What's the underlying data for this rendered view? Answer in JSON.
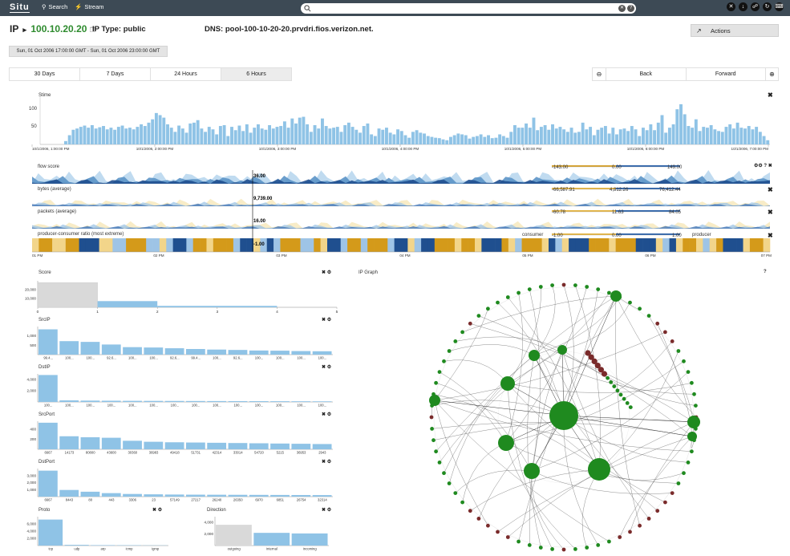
{
  "app": {
    "brand": "Situ",
    "nav": [
      {
        "label": "Search"
      },
      {
        "label": "Stream"
      }
    ],
    "search": {
      "value": "",
      "placeholder": ""
    }
  },
  "header": {
    "ip_label": "IP",
    "ip_value": "100.10.20.20",
    "ip_type": "IP Type: public",
    "dns": "DNS: pool-100-10-20-20.prvdri.fios.verizon.net.",
    "actions_label": "Actions",
    "date_range": "Sun, 01 Oct 2006 17:00:00 GMT - Sun, 01 Oct 2006 23:00:00 GMT"
  },
  "range_tabs": [
    {
      "label": "30 Days",
      "active": false
    },
    {
      "label": "7 Days",
      "active": false
    },
    {
      "label": "24 Hours",
      "active": false
    },
    {
      "label": "6 Hours",
      "active": true
    }
  ],
  "nav_tabs": {
    "back": "Back",
    "forward": "Forward"
  },
  "stime": {
    "title": "Stime",
    "y_ticks": [
      "100",
      "50"
    ],
    "x_labels": [
      "10/1/2006, 1:00:00 PM",
      "10/1/2006, 2:00:00 PM",
      "10/1/2006, 3:00:00 PM",
      "10/1/2006, 4:00:00 PM",
      "10/1/2006, 5:00:00 PM",
      "10/1/2006, 6:00:00 PM",
      "10/1/2006, 7:00:00 PM"
    ],
    "values": [
      8,
      22,
      35,
      38,
      42,
      45,
      40,
      46,
      38,
      41,
      44,
      36,
      40,
      35,
      42,
      45,
      38,
      40,
      36,
      42,
      48,
      44,
      52,
      60,
      75,
      70,
      64,
      48,
      40,
      30,
      45,
      38,
      28,
      50,
      52,
      58,
      38,
      30,
      42,
      36,
      24,
      44,
      46,
      20,
      42,
      34,
      45,
      32,
      48,
      28,
      40,
      48,
      38,
      35,
      46,
      38,
      42,
      44,
      55,
      40,
      62,
      50,
      64,
      66,
      48,
      30,
      46,
      38,
      62,
      44,
      38,
      40,
      42,
      30,
      46,
      52,
      42,
      35,
      28,
      44,
      50,
      24,
      20,
      38,
      35,
      40,
      28,
      24,
      36,
      32,
      22,
      16,
      30,
      34,
      28,
      26,
      20,
      18,
      16,
      15,
      12,
      10,
      18,
      22,
      26,
      24,
      22,
      14,
      18,
      20,
      24,
      18,
      22,
      15,
      16,
      24,
      20,
      16,
      30,
      46,
      40,
      40,
      50,
      40,
      64,
      34,
      42,
      46,
      35,
      48,
      38,
      42,
      36,
      30,
      40,
      28,
      30,
      52,
      36,
      42,
      22,
      35,
      40,
      44,
      26,
      40,
      24,
      36,
      38,
      32,
      44,
      36,
      20,
      40,
      34,
      48,
      34,
      52,
      70,
      28,
      40,
      48,
      84,
      96,
      72,
      44,
      40,
      60,
      32,
      42,
      40,
      46,
      36,
      32,
      30,
      42,
      48,
      38,
      52,
      40,
      38,
      44,
      36,
      42,
      30,
      20,
      10
    ]
  },
  "tracks": [
    {
      "title": "flow score",
      "readout": "36.00",
      "legend": [
        "-143.00",
        "0.00",
        "149.00"
      ]
    },
    {
      "title": "bytes (average)",
      "readout": "9,739.00",
      "legend": [
        "-66,587.91",
        "4,812.26",
        "76,412.44"
      ]
    },
    {
      "title": "packets (average)",
      "readout": "16.00",
      "legend": [
        "-60.78",
        "11.63",
        "84.05"
      ]
    },
    {
      "title": "producer-consumer ratio (most extreme)",
      "readout": "-1.00",
      "legend": [
        "-1.00",
        "0.00",
        "1.00"
      ],
      "left_label": "consumer",
      "right_label": "producer"
    }
  ],
  "track_axis": [
    "01 PM",
    "02 PM",
    "03 PM",
    "04 PM",
    "05 PM",
    "06 PM",
    "07 PM"
  ],
  "histograms": {
    "score": {
      "title": "Score",
      "y_ticks": [
        "20,000",
        "10,000"
      ],
      "x_ticks": [
        "0",
        "1",
        "2",
        "3",
        "4",
        "5"
      ],
      "values": [
        28000,
        7000,
        1600,
        0,
        0
      ],
      "colors": [
        "#d9d9d9",
        "#8fc3e6",
        "#8fc3e6",
        "#8fc3e6",
        "#8fc3e6"
      ]
    },
    "srcip": {
      "title": "SrcIP",
      "y_ticks": [
        "1,000",
        "500"
      ],
      "categories": [
        "99.4...",
        "100...",
        "100...",
        "92.6...",
        "100...",
        "100...",
        "92.6...",
        "99.4...",
        "100...",
        "92.6...",
        "100...",
        "100...",
        "100...",
        "100..."
      ],
      "values": [
        1350,
        720,
        680,
        540,
        400,
        380,
        340,
        300,
        270,
        250,
        220,
        210,
        190,
        180
      ]
    },
    "dstip": {
      "title": "DstIP",
      "y_ticks": [
        "4,000",
        "2,000"
      ],
      "categories": [
        "100...",
        "100...",
        "100...",
        "100...",
        "100...",
        "100...",
        "100...",
        "100...",
        "100...",
        "100...",
        "100...",
        "100...",
        "100...",
        "100..."
      ],
      "values": [
        4800,
        280,
        240,
        220,
        200,
        190,
        180,
        170,
        160,
        150,
        140,
        130,
        120,
        110
      ]
    },
    "srcport": {
      "title": "SrcPort",
      "y_ticks": [
        "400",
        "200"
      ],
      "categories": [
        "6667",
        "14173",
        "80800",
        "43600",
        "30360",
        "36983",
        "49418",
        "51731",
        "42314",
        "33014",
        "54720",
        "5215",
        "36953",
        "2943"
      ],
      "values": [
        530,
        260,
        240,
        230,
        170,
        150,
        140,
        135,
        130,
        125,
        120,
        115,
        110,
        105
      ]
    },
    "dstport": {
      "title": "DstPort",
      "y_ticks": [
        "3,000",
        "2,000",
        "1,000"
      ],
      "categories": [
        "6667",
        "8443",
        "80",
        "443",
        "3306",
        "23",
        "57149",
        "27217",
        "26240",
        "26350",
        "6970",
        "6851",
        "26754",
        "32314"
      ],
      "values": [
        3700,
        950,
        700,
        500,
        380,
        330,
        300,
        280,
        270,
        260,
        250,
        240,
        230,
        220
      ]
    },
    "proto": {
      "title": "Proto",
      "y_ticks": [
        "6,000",
        "4,000",
        "2,000"
      ],
      "categories": [
        "tcp",
        "udp",
        "arp",
        "icmp",
        "igmp"
      ],
      "values": [
        7200,
        200,
        120,
        100,
        60
      ]
    },
    "direction": {
      "title": "Direction",
      "y_ticks": [
        "4,000",
        "2,000"
      ],
      "categories": [
        "outgoing",
        "internal",
        "incoming"
      ],
      "values": [
        3600,
        2200,
        2100
      ],
      "colors": [
        "#d9d9d9",
        "#8fc3e6",
        "#8fc3e6"
      ]
    }
  },
  "ip_graph": {
    "title": "IP Graph",
    "help": "?"
  },
  "colors": {
    "bar": "#8fc3e6",
    "node_green": "#1f8a1f",
    "node_red": "#7a2b2b",
    "topbar": "#3d4a55"
  }
}
